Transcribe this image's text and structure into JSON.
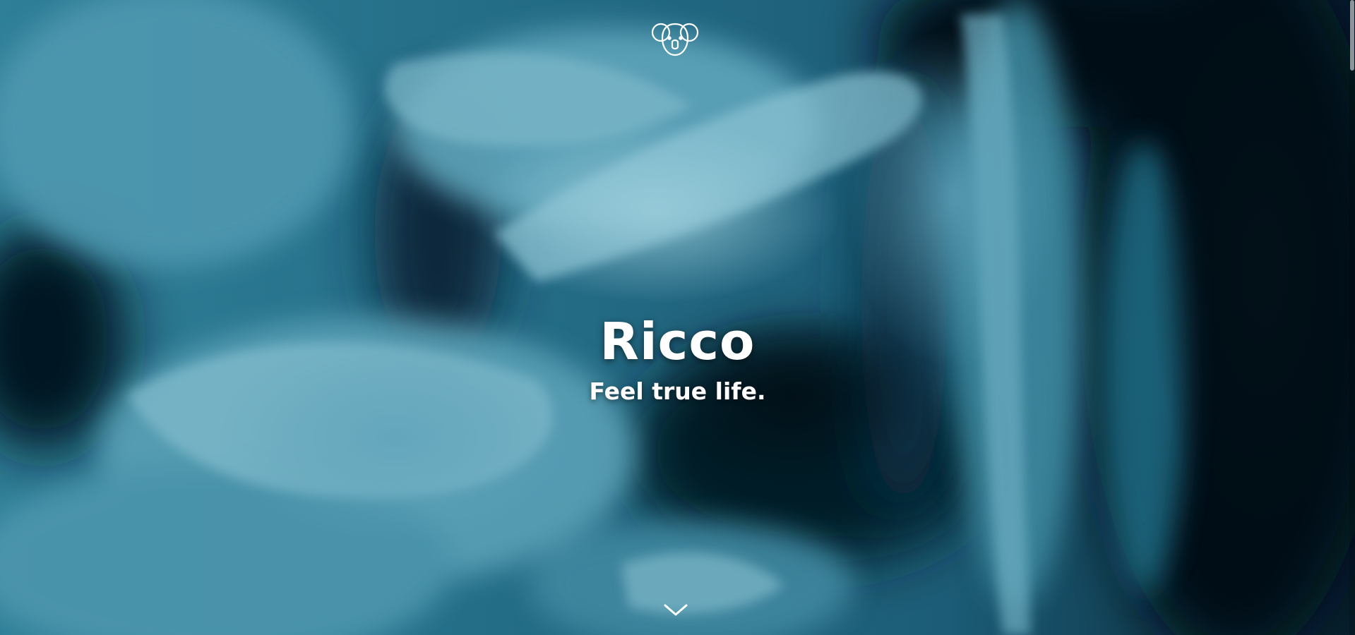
{
  "hero": {
    "title": "Ricco",
    "tagline": "Feel true life."
  },
  "icons": {
    "logo": "koala-icon",
    "scroll": "chevron-down-icon"
  },
  "colors": {
    "text": "#ffffff",
    "background_dark": "#04121c",
    "smoke_light": "#7fb8c9",
    "smoke_mid": "#2c7790",
    "smoke_deep": "#0e3c52"
  }
}
